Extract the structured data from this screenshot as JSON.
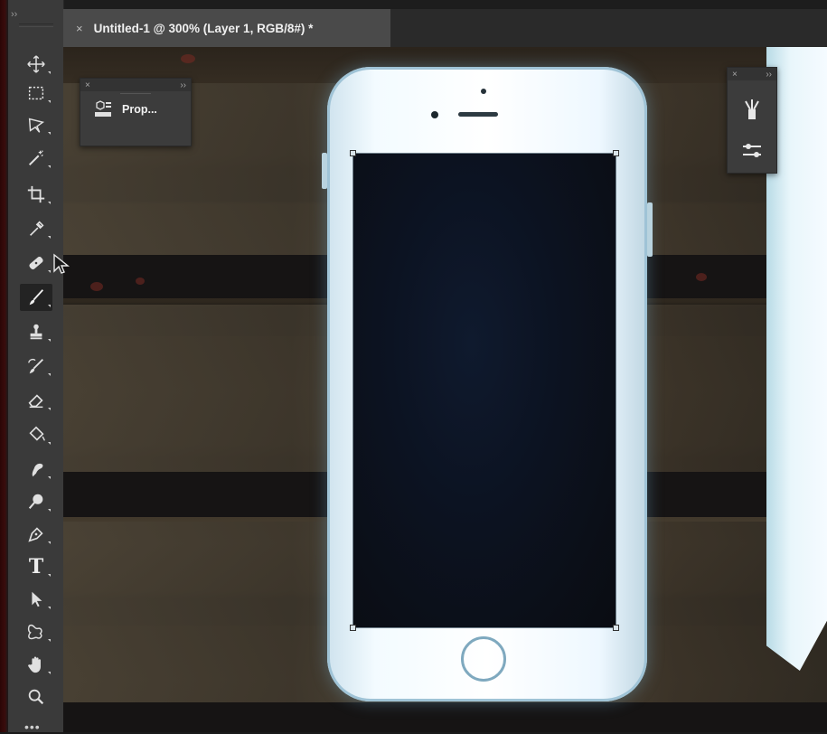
{
  "document": {
    "tab_close": "×",
    "tab_title": "Untitled-1 @ 300% (Layer 1, RGB/8#) *"
  },
  "toolbar": {
    "collapse_glyph": "››",
    "active_tool": "brush",
    "tools": [
      "move",
      "marquee",
      "lasso",
      "magic-wand",
      "crop",
      "eyedropper",
      "healing-brush",
      "brush",
      "clone-stamp",
      "history-brush",
      "eraser",
      "paint-bucket",
      "smudge",
      "dodge",
      "pen",
      "type",
      "path-selection",
      "custom-shape",
      "hand",
      "zoom"
    ],
    "type_tool_glyph": "T"
  },
  "properties_panel": {
    "close": "×",
    "expand": "››",
    "label": "Prop..."
  },
  "right_panel": {
    "close": "×",
    "expand": "››",
    "buttons": [
      "brush-settings",
      "adjustments"
    ]
  },
  "colors": {
    "toolbar_bg": "#3a3a3a",
    "active_tab": "#4a4a4a",
    "tab_bar": "#2a2a2a"
  }
}
